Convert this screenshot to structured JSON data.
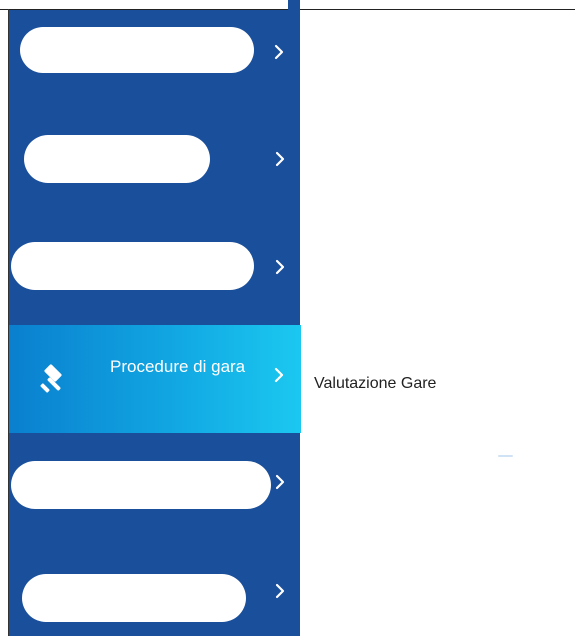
{
  "sidebar": {
    "items": [
      {
        "label": "",
        "redacted": true,
        "icon": "chevron-right-icon"
      },
      {
        "label": "",
        "redacted": true,
        "icon": "chevron-right-icon"
      },
      {
        "label": "",
        "redacted": true,
        "icon": "chevron-right-icon"
      },
      {
        "label": "Procedure di gara",
        "active": true,
        "icon": "gavel-icon",
        "chevron": "chevron-right-icon"
      },
      {
        "label": "",
        "redacted": true,
        "icon": "chevron-right-icon"
      },
      {
        "label": "",
        "redacted": true,
        "icon": "chevron-right-icon"
      }
    ],
    "background_color": "#1a4f9c",
    "active_gradient": [
      "#0a7fce",
      "#1bc8f0"
    ]
  },
  "submenu": {
    "items": [
      "Valutazione Gare"
    ]
  }
}
